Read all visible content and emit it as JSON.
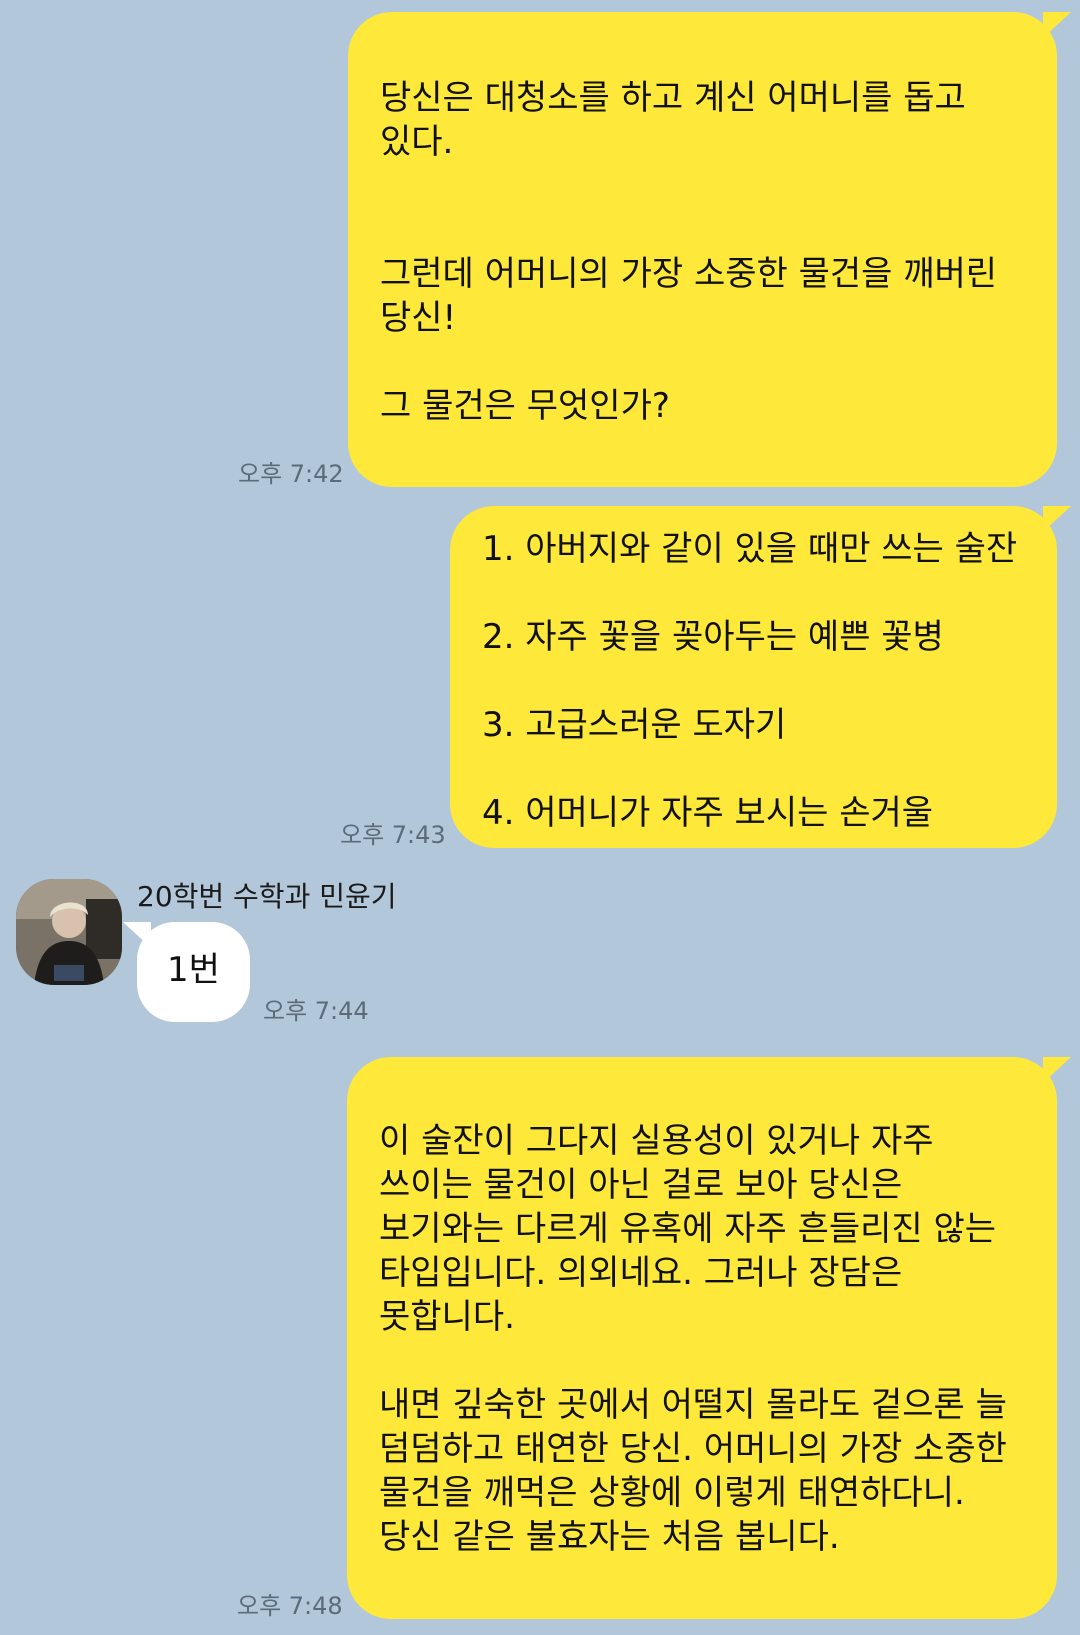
{
  "messages": [
    {
      "side": "mine",
      "text": "당신은 대청소를 하고 계신 어머니를 돕고 있다.\n\n\n그런데 어머니의 가장 소중한 물건을 깨버린 당신!\n\n그 물건은 무엇인가?",
      "time": "오후 7:42"
    },
    {
      "side": "mine",
      "text": "1. 아버지와 같이 있을 때만 쓰는 술잔\n\n2. 자주 꽃을 꽂아두는 예쁜 꽃병\n\n3. 고급스러운 도자기\n\n4. 어머니가 자주 보시는 손거울",
      "time": "오후 7:43"
    },
    {
      "side": "theirs",
      "sender": "20학번 수학과 민윤기",
      "avatar_icon": "profile-photo",
      "text": "1번",
      "time": "오후 7:44"
    },
    {
      "side": "mine",
      "text": "이 술잔이 그다지 실용성이 있거나 자주 쓰이는 물건이 아닌 걸로 보아 당신은 보기와는 다르게 유혹에 자주 흔들리진 않는 타입입니다. 의외네요. 그러나 장담은 못합니다.\n\n내면 깊숙한 곳에서 어떨지 몰라도 겉으론 늘 덤덤하고 태연한 당신. 어머니의 가장 소중한 물건을 깨먹은 상황에 이렇게 태연하다니. 당신 같은 불효자는 처음 봅니다.",
      "time": "오후 7:48"
    }
  ],
  "colors": {
    "background": "#b2c7da",
    "my_bubble": "#fee93a",
    "their_bubble": "#ffffff",
    "timestamp": "#5b6b78"
  }
}
